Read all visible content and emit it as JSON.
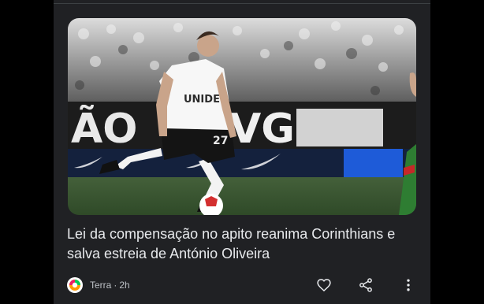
{
  "article": {
    "headline": "Lei da compensação no apito reanima Corinthians e salva estreia de António Oliveira",
    "source": "Terra",
    "separator": "·",
    "time": "2h",
    "image_alt": "Jogador do Corinthians conduzindo a bola em campo",
    "jersey_text": "UNIDE"
  },
  "actions": {
    "like_icon": "heart-icon",
    "share_icon": "share-icon",
    "more_icon": "more-vert-icon"
  },
  "colors": {
    "card_background": "#202124",
    "headline_text": "#e8eaed",
    "meta_text": "#bdc1c6",
    "icon": "#e8eaed"
  }
}
